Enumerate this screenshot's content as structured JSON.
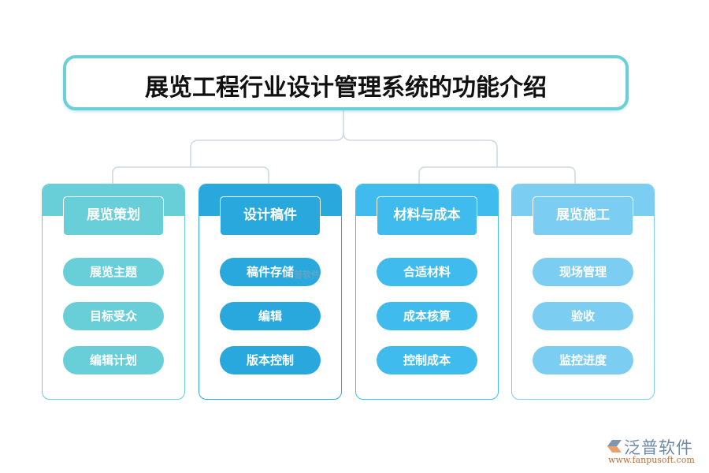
{
  "title": "展览工程行业设计管理系统的功能介绍",
  "columns": [
    {
      "heading": "展览策划",
      "color": "#68cfd8",
      "items": [
        "展览主题",
        "目标受众",
        "编辑计划"
      ]
    },
    {
      "heading": "设计稿件",
      "color": "#29a8de",
      "items": [
        "稿件存储",
        "编辑",
        "版本控制"
      ]
    },
    {
      "heading": "材料与成本",
      "color": "#3fbced",
      "items": [
        "合适材料",
        "成本核算",
        "控制成本"
      ]
    },
    {
      "heading": "展览施工",
      "color": "#7ccdf2",
      "items": [
        "现场管理",
        "验收",
        "监控进度"
      ]
    }
  ],
  "connector_color": "#cfd9e3",
  "watermark": "泛普软件",
  "logo": {
    "brand": "泛普软件",
    "url": "www.fanpusoft.com"
  }
}
